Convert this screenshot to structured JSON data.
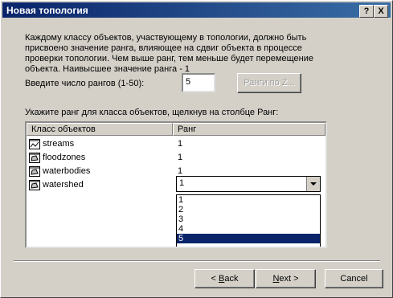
{
  "window": {
    "title": "Новая топология",
    "help_label": "?",
    "close_label": "X"
  },
  "description": "Каждому классу объектов, участвующему в топологии, должно быть присвоено значение ранга, влияющее на сдвиг объекта в процессе проверки топологии. Чем выше ранг, тем меньше будет перемещение объекта. Наивысшее значение ранга - 1",
  "ranks_prompt": "Введите число рангов  (1-50):",
  "ranks_value": "5",
  "ranks_button": "Ранги по Z...",
  "list_prompt": "Укажите ранг для класса объектов, щелкнув на столбце Ранг:",
  "table": {
    "col_class": "Класс объектов",
    "col_rank": "Ранг",
    "rows": [
      {
        "name": "streams",
        "rank": "1",
        "icon": "line-feature-class-icon"
      },
      {
        "name": "floodzones",
        "rank": "1",
        "icon": "polygon-feature-class-icon"
      },
      {
        "name": "waterbodies",
        "rank": "1",
        "icon": "polygon-feature-class-icon"
      },
      {
        "name": "watershed",
        "rank": "1",
        "icon": "polygon-feature-class-icon"
      }
    ]
  },
  "rank_dropdown": {
    "value": "1",
    "options": [
      "1",
      "2",
      "3",
      "4",
      "5"
    ],
    "highlighted": "5"
  },
  "buttons": {
    "back_pre": "< ",
    "back_u": "B",
    "back_post": "ack",
    "next_u": "N",
    "next_post": "ext >",
    "cancel": "Cancel"
  }
}
